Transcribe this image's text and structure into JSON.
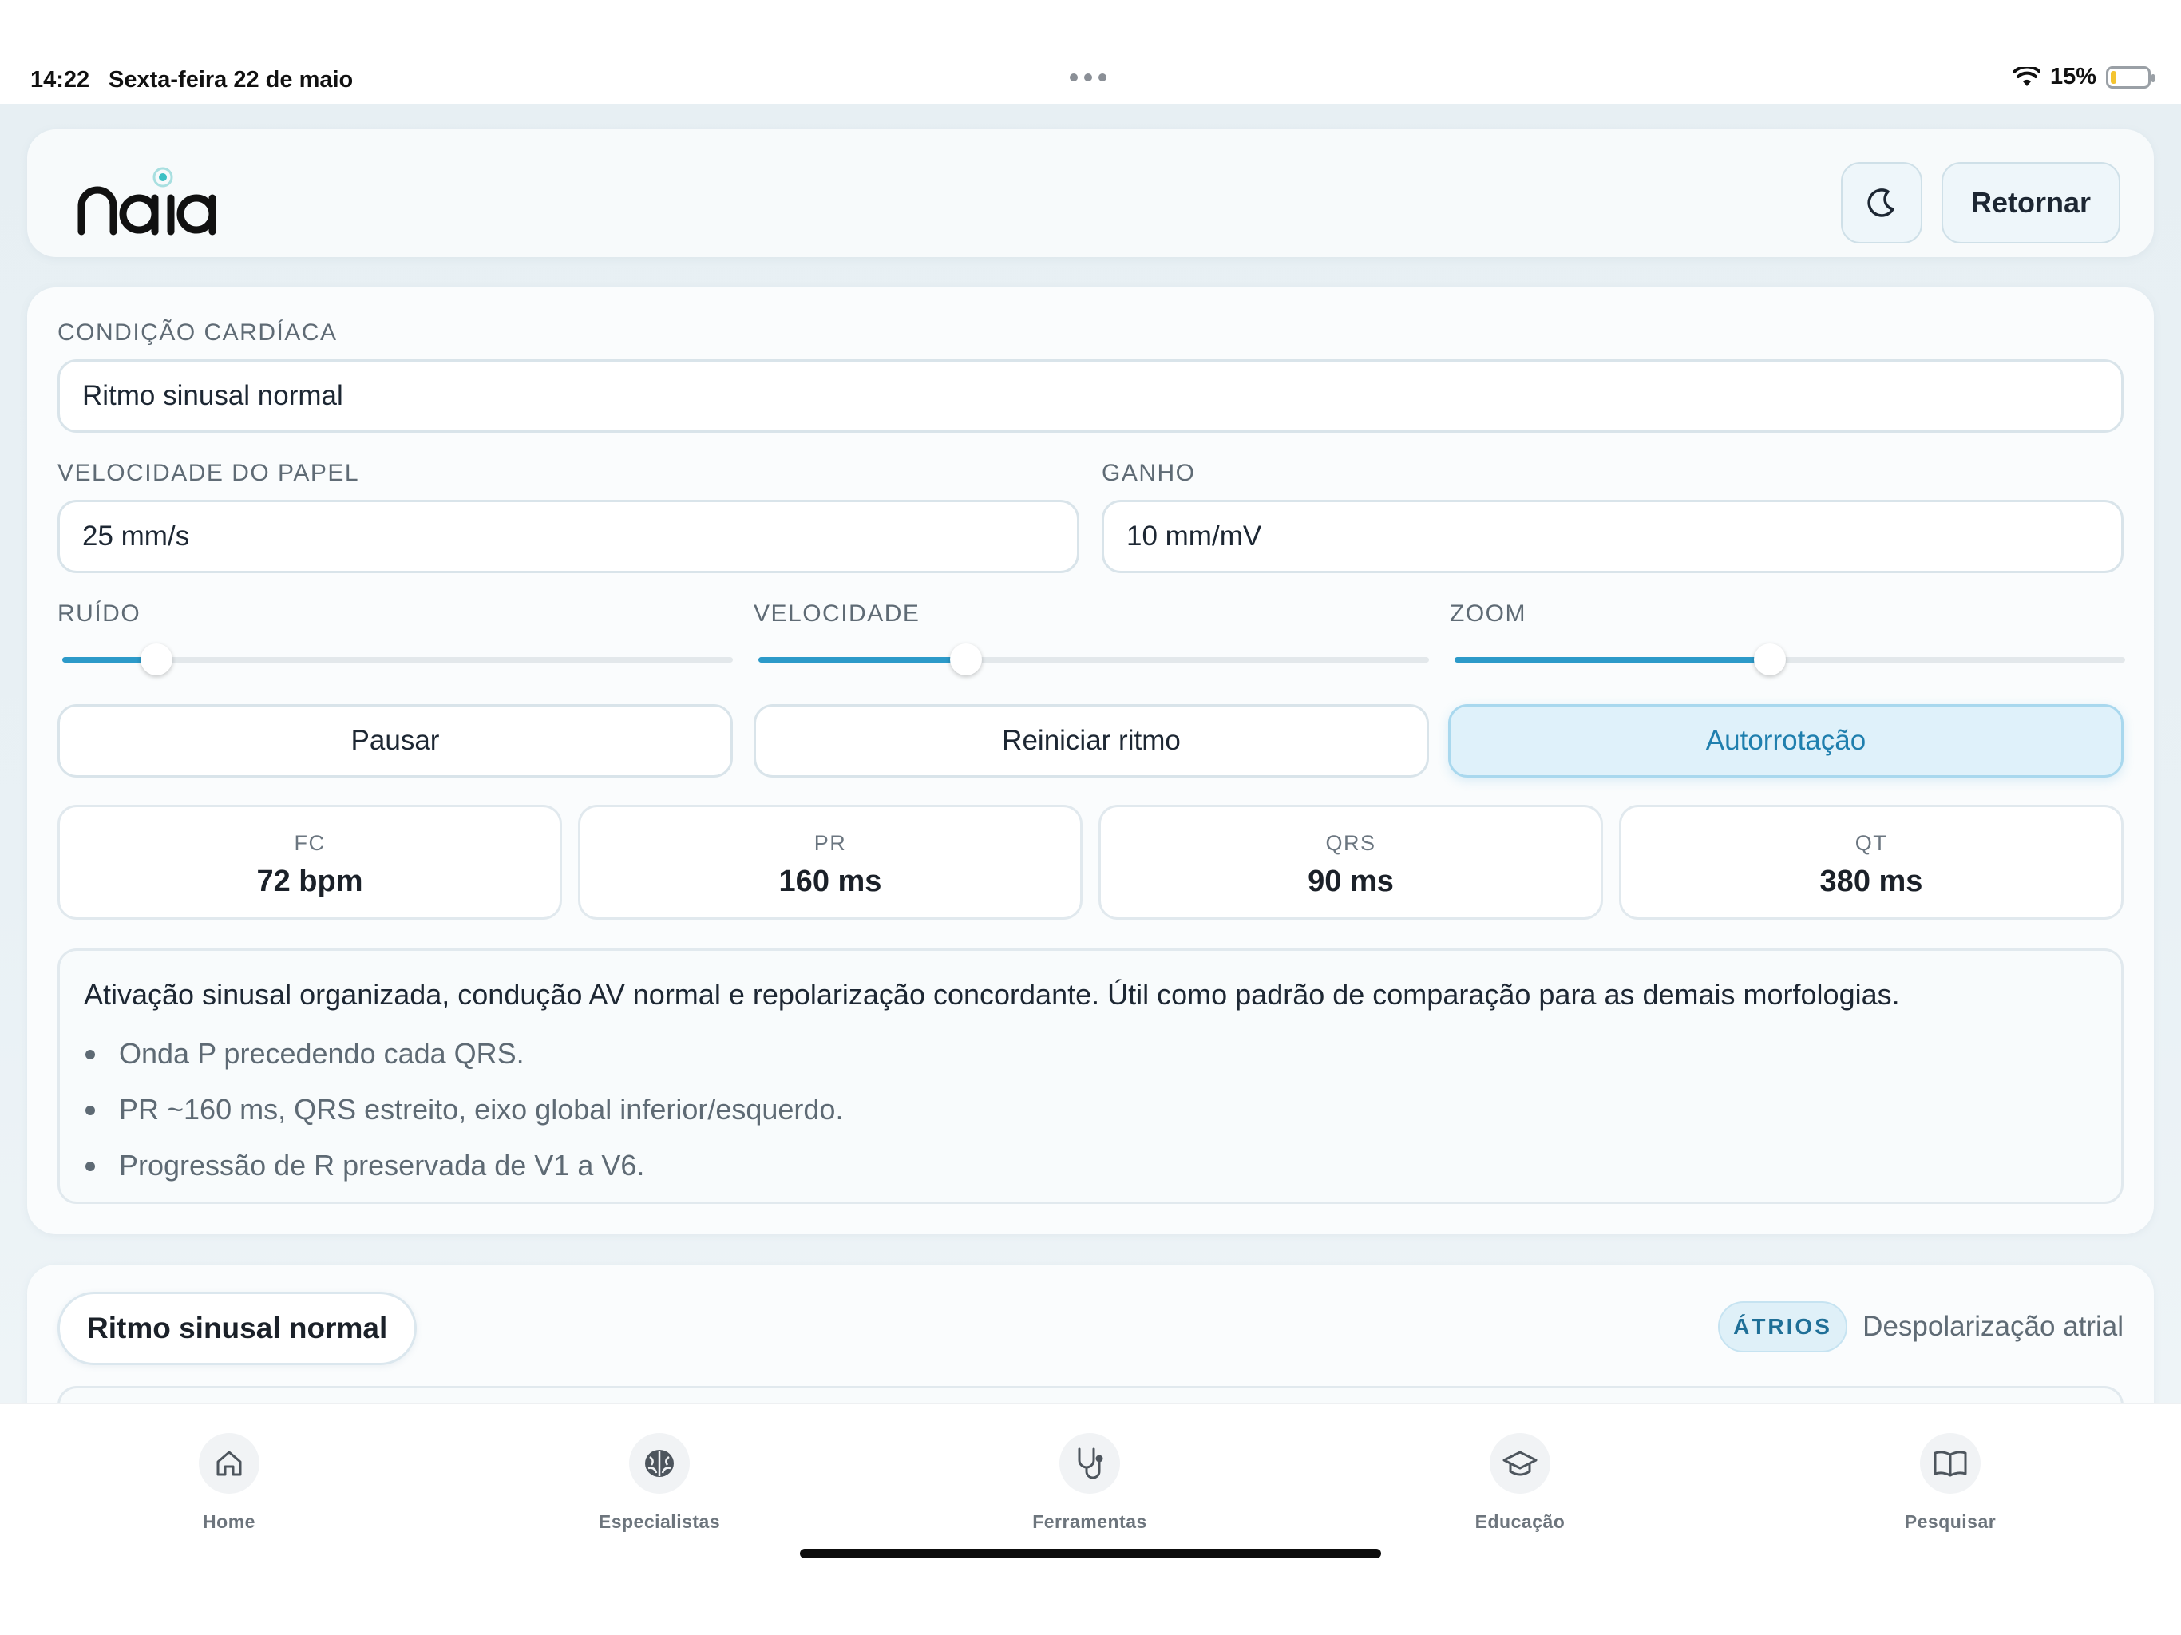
{
  "status_bar": {
    "time": "14:22",
    "date": "Sexta-feira 22 de maio",
    "battery_percent": "15%",
    "battery_level": 0.15
  },
  "header": {
    "logo_text": "naia",
    "theme_icon": "moon-icon",
    "return_label": "Retornar"
  },
  "controls": {
    "condition": {
      "label": "CONDIÇÃO CARDÍACA",
      "value": "Ritmo sinusal normal"
    },
    "paper_speed": {
      "label": "VELOCIDADE DO PAPEL",
      "value": "25 mm/s"
    },
    "gain": {
      "label": "GANHO",
      "value": "10 mm/mV"
    },
    "sliders": [
      {
        "label": "RUÍDO",
        "level": 0.14
      },
      {
        "label": "VELOCIDADE",
        "level": 0.31
      },
      {
        "label": "ZOOM",
        "level": 0.47
      }
    ],
    "buttons": {
      "pause": "Pausar",
      "restart": "Reiniciar ritmo",
      "autorotate": "Autorrotação"
    }
  },
  "metrics": [
    {
      "label": "FC",
      "value": "72 bpm"
    },
    {
      "label": "PR",
      "value": "160 ms"
    },
    {
      "label": "QRS",
      "value": "90 ms"
    },
    {
      "label": "QT",
      "value": "380 ms"
    }
  ],
  "description": {
    "text": "Ativação sinusal organizada, condução AV normal e repolarização concordante. Útil como padrão de comparação para as demais morfologias.",
    "bullets": [
      "Onda P precedendo cada QRS.",
      "PR ~160 ms, QRS estreito, eixo global inferior/esquerdo.",
      "Progressão de R preservada de V1 a V6."
    ]
  },
  "rhythm_section": {
    "title": "Ritmo sinusal normal",
    "badge": "ÁTRIOS",
    "badge_desc": "Despolarização atrial"
  },
  "tabbar": [
    {
      "label": "Home",
      "icon": "home-icon"
    },
    {
      "label": "Especialistas",
      "icon": "brain-icon"
    },
    {
      "label": "Ferramentas",
      "icon": "stethoscope-icon"
    },
    {
      "label": "Educação",
      "icon": "graduation-cap-icon"
    },
    {
      "label": "Pesquisar",
      "icon": "book-icon"
    }
  ],
  "colors": {
    "accent": "#2c9ac9",
    "active_button_bg": "#dff1fa",
    "active_button_text": "#1f7fae",
    "battery": "#f4c430"
  }
}
